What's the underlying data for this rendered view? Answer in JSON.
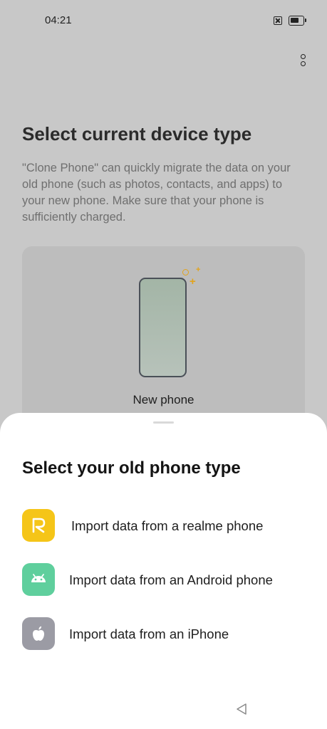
{
  "status_bar": {
    "time": "04:21",
    "icons": [
      "sim-card-x-icon",
      "battery-icon"
    ]
  },
  "header": {
    "menu_icon": "more-vertical-icon"
  },
  "main": {
    "title": "Select current device type",
    "description": "\"Clone Phone\" can quickly migrate the data on your old phone (such as photos, contacts, and apps) to your new phone. Make sure that your phone is sufficiently charged.",
    "device_card": {
      "label": "New phone",
      "illustration": "phone-illustration"
    }
  },
  "sheet": {
    "title": "Select your old phone type",
    "options": [
      {
        "label": "Import data from a realme phone",
        "icon": "realme-icon",
        "color": "#f5c518"
      },
      {
        "label": "Import data from an Android phone",
        "icon": "android-icon",
        "color": "#5fcf9d"
      },
      {
        "label": "Import data from an iPhone",
        "icon": "apple-icon",
        "color": "#9b9ba4"
      }
    ]
  },
  "nav": {
    "back_icon": "back-triangle-icon"
  },
  "colors": {
    "scrim": "#c8c8c8",
    "sparkle": "#e2a31b"
  }
}
